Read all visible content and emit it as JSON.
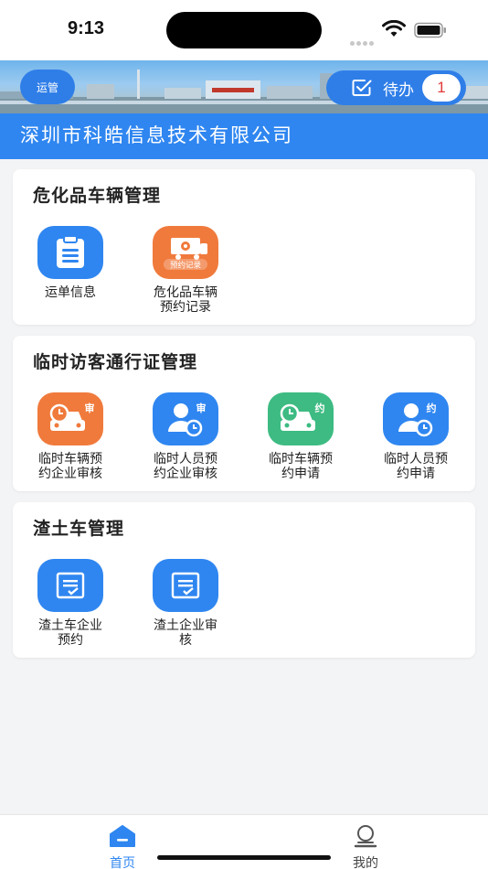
{
  "status_bar": {
    "time": "9:13"
  },
  "header": {
    "badge": "运管",
    "todo_label": "待办",
    "todo_count": "1",
    "company_name": "深圳市科皓信息技术有限公司"
  },
  "sections": [
    {
      "title": "危化品车辆管理",
      "items": [
        {
          "label_line1": "运单信息",
          "label_line2": "",
          "icon": "document-list-icon"
        },
        {
          "label_line1": "危化品车辆",
          "label_line2": "预约记录",
          "icon": "hazmat-truck-icon",
          "icon_text": "预约记录"
        }
      ]
    },
    {
      "title": "临时访客通行证管理",
      "items": [
        {
          "label_line1": "临时车辆预",
          "label_line2": "约企业审核",
          "icon": "car-clock-icon",
          "icon_text": "审"
        },
        {
          "label_line1": "临时人员预",
          "label_line2": "约企业审核",
          "icon": "person-clock-icon",
          "icon_text": "审"
        },
        {
          "label_line1": "临时车辆预",
          "label_line2": "约申请",
          "icon": "car-clock-icon",
          "icon_text": "约"
        },
        {
          "label_line1": "临时人员预",
          "label_line2": "约申请",
          "icon": "person-clock-icon",
          "icon_text": "约"
        }
      ]
    },
    {
      "title": "渣土车管理",
      "items": [
        {
          "label_line1": "渣土车企业",
          "label_line2": "预约",
          "icon": "form-check-icon"
        },
        {
          "label_line1": "渣土企业审",
          "label_line2": "核",
          "icon": "form-check-icon"
        }
      ]
    }
  ],
  "tabs": [
    {
      "label": "首页",
      "icon": "home-icon",
      "active": true
    },
    {
      "label": "我的",
      "icon": "user-icon",
      "active": false
    }
  ],
  "colors": {
    "primary": "#2f86f0",
    "orange": "#f07a3c",
    "green": "#3dbb82",
    "badge_red": "#e23a3a"
  }
}
